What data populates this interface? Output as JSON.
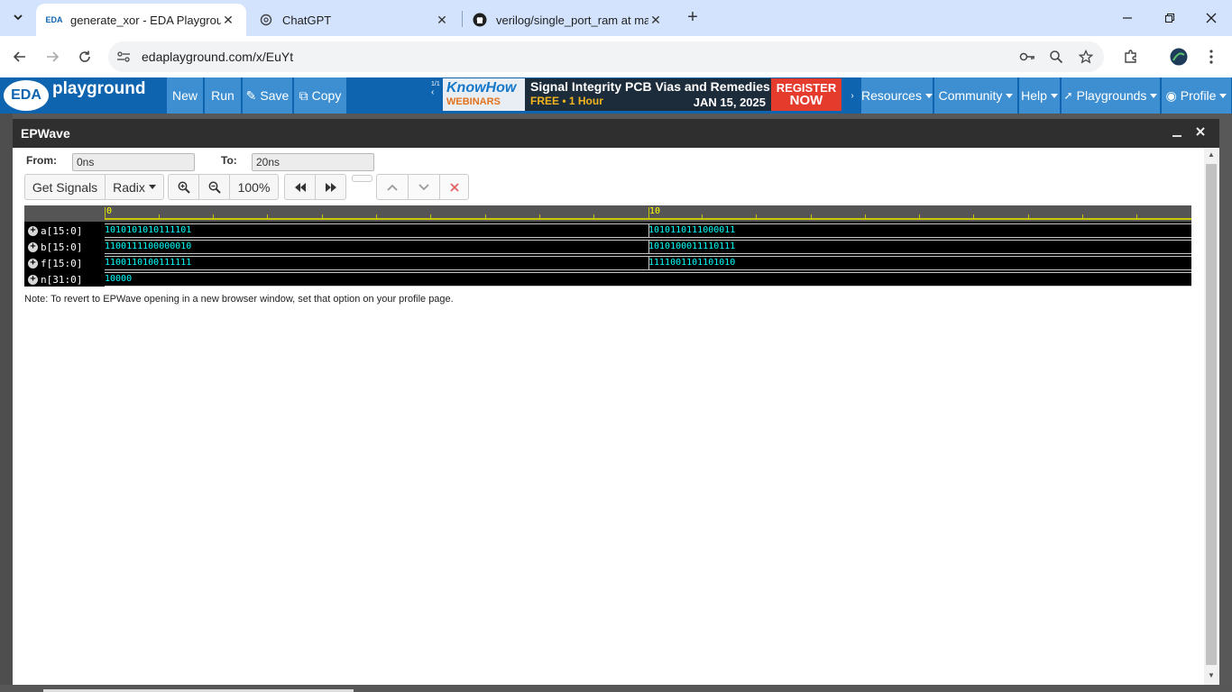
{
  "browser": {
    "tabs": [
      {
        "title": "generate_xor - EDA Playground",
        "favicon": "eda-favicon",
        "active": true
      },
      {
        "title": "ChatGPT",
        "favicon": "chatgpt-favicon",
        "active": false
      },
      {
        "title": "verilog/single_port_ram at main",
        "favicon": "github-favicon",
        "active": false
      }
    ],
    "url": "edaplayground.com/x/EuYt"
  },
  "edabar": {
    "logo_badge": "EDA",
    "logo_word": "playground",
    "buttons": {
      "new": "New",
      "run": "Run",
      "save": "Save",
      "copy": "Copy"
    },
    "ad_counter": "1/1",
    "ad": {
      "brand1": "KnowHow",
      "brand2": "WEBINARS",
      "headline": "Signal Integrity PCB Vias and Remedies",
      "sub": "FREE • 1 Hour",
      "date": "JAN 15, 2025",
      "cta1": "REGISTER",
      "cta2": "NOW"
    },
    "menus": {
      "resources": "Resources",
      "community": "Community",
      "help": "Help",
      "playgrounds": "Playgrounds",
      "profile": "Profile"
    }
  },
  "epwave": {
    "title": "EPWave",
    "from_label": "From:",
    "from_value": "0ns",
    "to_label": "To:",
    "to_value": "20ns",
    "get_signals": "Get Signals",
    "radix": "Radix",
    "zoom_level": "100%",
    "ruler": {
      "t0": "0",
      "t1": "10"
    },
    "signals": [
      {
        "name": "a[15:0]",
        "v0": "1010101010111101",
        "v1": "1010110111000011"
      },
      {
        "name": "b[15:0]",
        "v0": "1100111100000010",
        "v1": "1010100011110111"
      },
      {
        "name": "f[15:0]",
        "v0": "1100110100111111",
        "v1": "1111001101101010"
      },
      {
        "name": "n[31:0]",
        "v0": "10000",
        "v1": ""
      }
    ],
    "note": "Note: To revert to EPWave opening in a new browser window, set that option on your profile page."
  }
}
